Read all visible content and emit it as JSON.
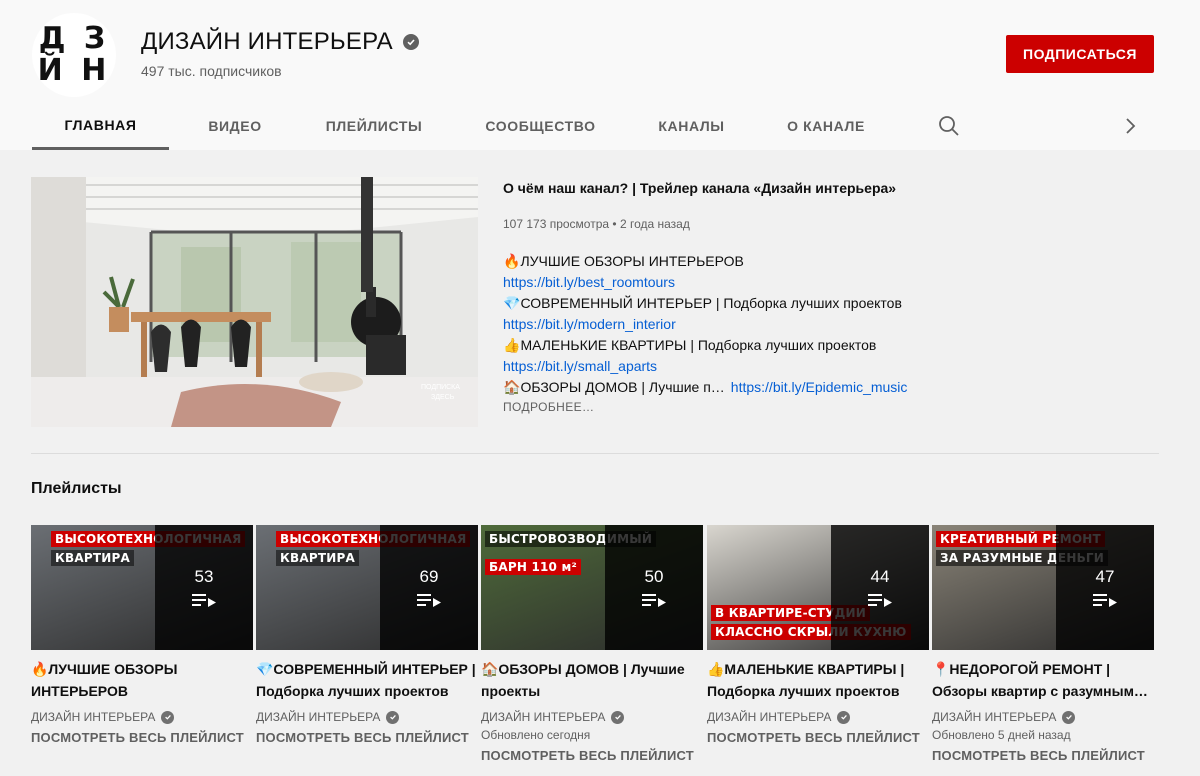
{
  "channel": {
    "avatar_line1": "Д З",
    "avatar_line2": "Й Н",
    "name": "ДИЗАЙН ИНТЕРЬЕРА",
    "subscribers": "497 тыс. подписчиков",
    "subscribe_label": "ПОДПИСАТЬСЯ"
  },
  "tabs": [
    "ГЛАВНАЯ",
    "ВИДЕО",
    "ПЛЕЙЛИСТЫ",
    "СООБЩЕСТВО",
    "КАНАЛЫ",
    "О КАНАЛЕ"
  ],
  "trailer": {
    "title": "О чём наш канал? | Трейлер канала «Дизайн интерьера»",
    "views": "107 173 просмотра",
    "age": "2 года назад",
    "watermark_1": "ПОДПИСКА",
    "watermark_2": "ЗДЕСЬ",
    "lines": [
      {
        "emoji": "🔥",
        "text": "ЛУЧШИЕ ОБЗОРЫ ИНТЕРЬЕРОВ"
      },
      {
        "link": "https://bit.ly/best_roomtours"
      },
      {
        "emoji": "💎",
        "text": "СОВРЕМЕННЫЙ ИНТЕРЬЕР | Подборка лучших проектов"
      },
      {
        "link": "https://bit.ly/modern_interior"
      },
      {
        "emoji": "👍",
        "text": "МАЛЕНЬКИЕ КВАРТИРЫ | Подборка лучших проектов"
      },
      {
        "link": "https://bit.ly/small_aparts"
      }
    ],
    "last_line_emoji": "🏠",
    "last_line_text": "ОБЗОРЫ ДОМОВ | Лучшие п…",
    "last_line_link": "https://bit.ly/Epidemic_music",
    "more_label": "ПОДРОБНЕЕ…"
  },
  "playlists_section_title": "Плейлисты",
  "playlists": [
    {
      "emoji": "🔥",
      "title_line1": "ЛУЧШИЕ ОБЗОРЫ",
      "title_line2": "ИНТЕРЬЕРОВ",
      "count": "53",
      "channel": "ДИЗАЙН ИНТЕРЬЕРА",
      "updated": "",
      "view_all": "ПОСМОТРЕТЬ ВЕСЬ ПЛЕЙЛИСТ",
      "banner1": "ВЫСОКОТЕХНОЛОГИЧНАЯ",
      "banner2": "КВАРТИРА",
      "bg": "#6b6f74"
    },
    {
      "emoji": "💎",
      "title_line1": "СОВРЕМЕННЫЙ ИНТЕРЬЕР |",
      "title_line2": "Подборка лучших проектов",
      "count": "69",
      "channel": "ДИЗАЙН ИНТЕРЬЕРА",
      "updated": "",
      "view_all": "ПОСМОТРЕТЬ ВЕСЬ ПЛЕЙЛИСТ",
      "banner1": "ВЫСОКОТЕХНОЛОГИЧНАЯ",
      "banner2": "КВАРТИРА",
      "bg": "#6b6f74"
    },
    {
      "emoji": "🏠",
      "title_line1": "ОБЗОРЫ ДОМОВ | Лучшие",
      "title_line2": "проекты",
      "count": "50",
      "channel": "ДИЗАЙН ИНТЕРЬЕРА",
      "updated": "Обновлено сегодня",
      "view_all": "ПОСМОТРЕТЬ ВЕСЬ ПЛЕЙЛИСТ",
      "banner1": "БЫСТРОВОЗВОДИМЫЙ",
      "banner2": "БАРН 110 м²",
      "bg": "#4f6b3a"
    },
    {
      "emoji": "👍",
      "title_line1": "МАЛЕНЬКИЕ КВАРТИРЫ |",
      "title_line2": "Подборка лучших проектов",
      "count": "44",
      "channel": "ДИЗАЙН ИНТЕРЬЕРА",
      "updated": "",
      "view_all": "ПОСМОТРЕТЬ ВЕСЬ ПЛЕЙЛИСТ",
      "banner1": "В КВАРТИРЕ-СТУДИИ",
      "banner2": "КЛАССНО СКРЫЛИ КУХНЮ",
      "bg": "#d9d6cf"
    },
    {
      "emoji": "📍",
      "title_line1": "НЕДОРОГОЙ РЕМОНТ |",
      "title_line2": "Обзоры квартир с разумным…",
      "count": "47",
      "channel": "ДИЗАЙН ИНТЕРЬЕРА",
      "updated": "Обновлено 5 дней назад",
      "view_all": "ПОСМОТРЕТЬ ВЕСЬ ПЛЕЙЛИСТ",
      "banner1": "КРЕАТИВНЫЙ РЕМОНТ",
      "banner2": "ЗА РАЗУМНЫЕ ДЕНЬГИ",
      "bg": "#8a8478"
    }
  ],
  "icons": {
    "search": "search-icon",
    "next": "chevron-right-icon",
    "verified": "verified-check-icon",
    "playlist": "playlist-play-icon"
  }
}
